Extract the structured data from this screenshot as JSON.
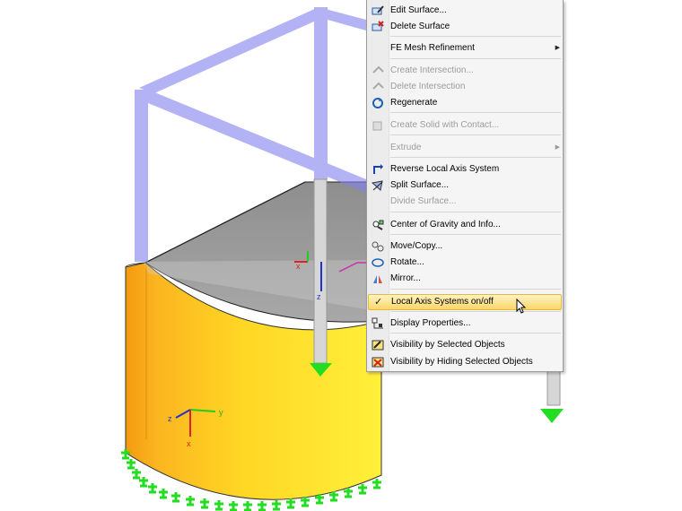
{
  "scene": {
    "axes_labels": {
      "x": "x",
      "y": "y",
      "z": "z"
    }
  },
  "context_menu": {
    "items": [
      {
        "label": "Edit Surface...",
        "enabled": true,
        "icon": "edit-surface-icon"
      },
      {
        "label": "Delete Surface",
        "enabled": true,
        "icon": "delete-surface-icon"
      },
      {
        "label": "FE Mesh Refinement",
        "enabled": true,
        "submenu": true
      },
      {
        "label": "Create Intersection...",
        "enabled": false,
        "icon": "create-intersection-icon"
      },
      {
        "label": "Delete Intersection",
        "enabled": false,
        "icon": "delete-intersection-icon"
      },
      {
        "label": "Regenerate",
        "enabled": true,
        "icon": "regenerate-icon"
      },
      {
        "label": "Create Solid with Contact...",
        "enabled": false,
        "icon": "create-solid-icon"
      },
      {
        "label": "Extrude",
        "enabled": false,
        "submenu": true
      },
      {
        "label": "Reverse Local Axis System",
        "enabled": true,
        "icon": "reverse-axis-icon"
      },
      {
        "label": "Split Surface...",
        "enabled": true,
        "icon": "split-surface-icon"
      },
      {
        "label": "Divide Surface...",
        "enabled": false
      },
      {
        "label": "Center of Gravity and Info...",
        "enabled": true,
        "icon": "center-of-gravity-icon"
      },
      {
        "label": "Move/Copy...",
        "enabled": true,
        "icon": "move-copy-icon"
      },
      {
        "label": "Rotate...",
        "enabled": true,
        "icon": "rotate-icon"
      },
      {
        "label": "Mirror...",
        "enabled": true,
        "icon": "mirror-icon"
      },
      {
        "label": "Local Axis Systems on/off",
        "enabled": true,
        "checked": true,
        "highlighted": true
      },
      {
        "label": "Display Properties...",
        "enabled": true,
        "icon": "display-properties-icon"
      },
      {
        "label": "Visibility by Selected Objects",
        "enabled": true,
        "icon": "visibility-selected-icon"
      },
      {
        "label": "Visibility by Hiding Selected Objects",
        "enabled": true,
        "icon": "visibility-hiding-icon"
      }
    ],
    "check_glyph": "✓",
    "submenu_glyph": "▶"
  },
  "colors": {
    "frame": "#8080f0",
    "cylinder": "#ffd21e",
    "support": "#22dd22",
    "highlight": "#fbd66a"
  }
}
